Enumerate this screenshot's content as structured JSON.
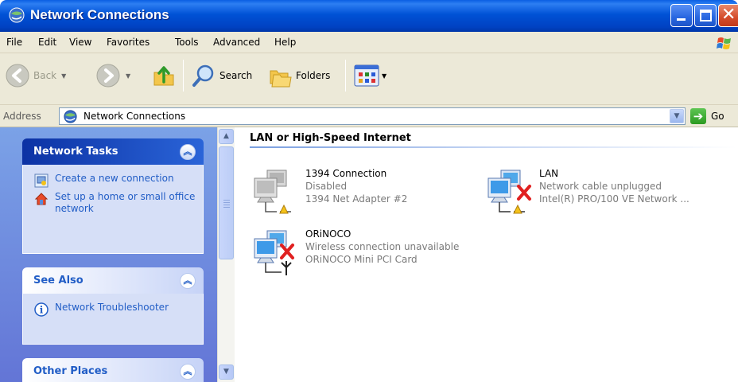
{
  "window": {
    "title": "Network Connections"
  },
  "menubar": {
    "items": [
      "File",
      "Edit",
      "View",
      "Favorites",
      "Tools",
      "Advanced",
      "Help"
    ]
  },
  "toolbar": {
    "back_label": "Back",
    "search_label": "Search",
    "folders_label": "Folders"
  },
  "addressbar": {
    "label": "Address",
    "value": "Network Connections",
    "go_label": "Go"
  },
  "taskpane": {
    "network_tasks": {
      "title": "Network Tasks",
      "items": [
        {
          "label": "Create a new connection",
          "icon": "new-connection-icon"
        },
        {
          "label": "Set up a home or small office network",
          "icon": "home-network-icon"
        }
      ]
    },
    "see_also": {
      "title": "See Also",
      "items": [
        {
          "label": "Network Troubleshooter",
          "icon": "info-icon"
        }
      ]
    },
    "other_places": {
      "title": "Other Places"
    }
  },
  "main": {
    "group_header": "LAN or High-Speed Internet",
    "connections": [
      {
        "name": "1394 Connection",
        "status": "Disabled",
        "device": "1394 Net Adapter #2",
        "state": "disabled"
      },
      {
        "name": "LAN",
        "status": "Network cable unplugged",
        "device": "Intel(R) PRO/100 VE Network ...",
        "state": "error"
      },
      {
        "name": "ORiNOCO",
        "status": "Wireless connection unavailable",
        "device": "ORiNOCO Mini PCI Card",
        "state": "error"
      }
    ]
  },
  "colors": {
    "titlebar": "#0052d6",
    "taskpane": "#6f8fe0",
    "link": "#215dc6",
    "error_x": "#e02020"
  }
}
